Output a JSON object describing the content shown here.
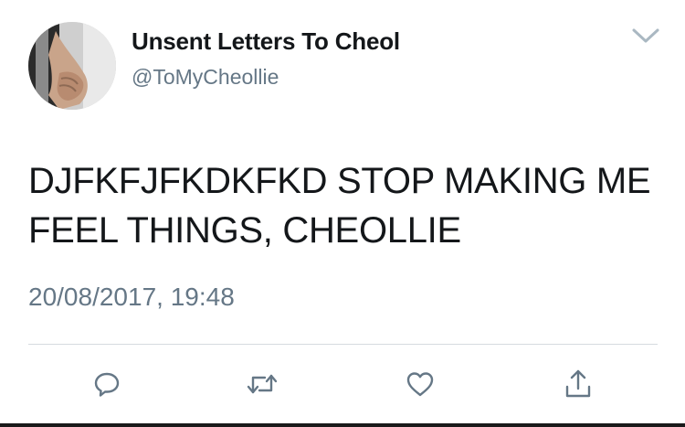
{
  "tweet": {
    "display_name": "Unsent Letters To Cheol",
    "handle": "@ToMyCheollie",
    "text": "DJFKFJFKDKFKD STOP MAKING ME FEEL THINGS, CHEOLLIE",
    "timestamp": "20/08/2017, 19:48"
  },
  "icons": {
    "menu": "chevron-down-icon",
    "reply": "reply-bubble-icon",
    "retweet": "retweet-icon",
    "like": "heart-icon",
    "share": "share-upload-icon"
  },
  "colors": {
    "text_primary": "#14171a",
    "text_secondary": "#657786",
    "icon": "#657786",
    "divider": "#d6dbdf"
  }
}
